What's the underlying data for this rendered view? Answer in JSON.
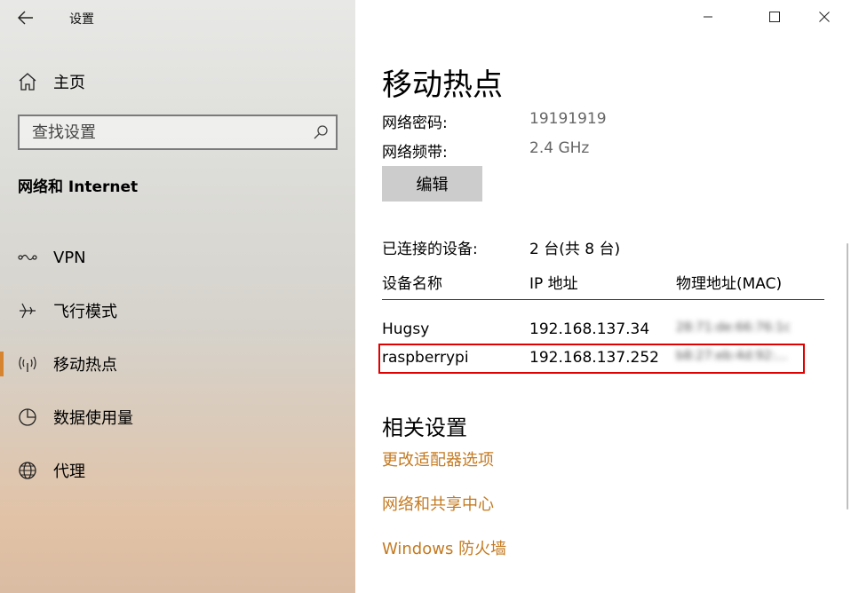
{
  "window": {
    "title": "设置"
  },
  "sidebar": {
    "home_label": "主页",
    "search_placeholder": "查找设置",
    "section_title": "网络和 Internet",
    "items": [
      {
        "label": "VPN",
        "icon": "vpn-icon"
      },
      {
        "label": "飞行模式",
        "icon": "airplane-icon"
      },
      {
        "label": "移动热点",
        "icon": "hotspot-icon",
        "active": true
      },
      {
        "label": "数据使用量",
        "icon": "data-usage-icon"
      },
      {
        "label": "代理",
        "icon": "globe-icon"
      }
    ],
    "accent_color": "#d6842f"
  },
  "main": {
    "page_title": "移动热点",
    "network_password_label": "网络密码:",
    "network_password_value": "19191919",
    "network_band_label": "网络频带:",
    "network_band_value": "2.4 GHz",
    "edit_button": "编辑",
    "connected_label": "已连接的设备:",
    "connected_value": "2 台(共 8 台)",
    "table": {
      "headers": [
        "设备名称",
        "IP 地址",
        "物理地址(MAC)"
      ],
      "rows": [
        {
          "name": "Hugsy",
          "ip": "192.168.137.34",
          "mac": "28:71:de:66:76:1c"
        },
        {
          "name": "raspberrypi",
          "ip": "192.168.137.252",
          "mac": "b8:27:eb:4d:92:..."
        }
      ]
    },
    "related_title": "相关设置",
    "links": [
      "更改适配器选项",
      "网络和共享中心",
      "Windows 防火墙"
    ],
    "link_color": "#c47a21",
    "highlight_color": "#e00000"
  }
}
